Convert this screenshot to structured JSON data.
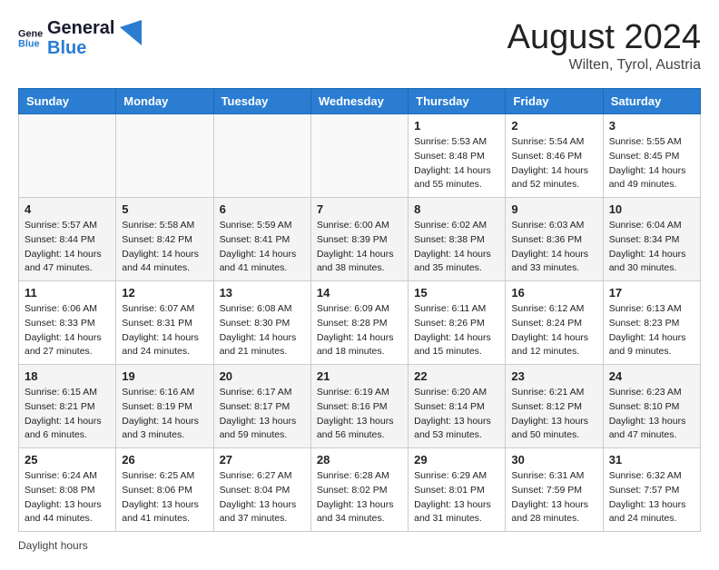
{
  "header": {
    "logo_general": "General",
    "logo_blue": "Blue",
    "month_title": "August 2024",
    "location": "Wilten, Tyrol, Austria"
  },
  "calendar": {
    "days_of_week": [
      "Sunday",
      "Monday",
      "Tuesday",
      "Wednesday",
      "Thursday",
      "Friday",
      "Saturday"
    ],
    "weeks": [
      [
        {
          "day": "",
          "info": ""
        },
        {
          "day": "",
          "info": ""
        },
        {
          "day": "",
          "info": ""
        },
        {
          "day": "",
          "info": ""
        },
        {
          "day": "1",
          "info": "Sunrise: 5:53 AM\nSunset: 8:48 PM\nDaylight: 14 hours and 55 minutes."
        },
        {
          "day": "2",
          "info": "Sunrise: 5:54 AM\nSunset: 8:46 PM\nDaylight: 14 hours and 52 minutes."
        },
        {
          "day": "3",
          "info": "Sunrise: 5:55 AM\nSunset: 8:45 PM\nDaylight: 14 hours and 49 minutes."
        }
      ],
      [
        {
          "day": "4",
          "info": "Sunrise: 5:57 AM\nSunset: 8:44 PM\nDaylight: 14 hours and 47 minutes."
        },
        {
          "day": "5",
          "info": "Sunrise: 5:58 AM\nSunset: 8:42 PM\nDaylight: 14 hours and 44 minutes."
        },
        {
          "day": "6",
          "info": "Sunrise: 5:59 AM\nSunset: 8:41 PM\nDaylight: 14 hours and 41 minutes."
        },
        {
          "day": "7",
          "info": "Sunrise: 6:00 AM\nSunset: 8:39 PM\nDaylight: 14 hours and 38 minutes."
        },
        {
          "day": "8",
          "info": "Sunrise: 6:02 AM\nSunset: 8:38 PM\nDaylight: 14 hours and 35 minutes."
        },
        {
          "day": "9",
          "info": "Sunrise: 6:03 AM\nSunset: 8:36 PM\nDaylight: 14 hours and 33 minutes."
        },
        {
          "day": "10",
          "info": "Sunrise: 6:04 AM\nSunset: 8:34 PM\nDaylight: 14 hours and 30 minutes."
        }
      ],
      [
        {
          "day": "11",
          "info": "Sunrise: 6:06 AM\nSunset: 8:33 PM\nDaylight: 14 hours and 27 minutes."
        },
        {
          "day": "12",
          "info": "Sunrise: 6:07 AM\nSunset: 8:31 PM\nDaylight: 14 hours and 24 minutes."
        },
        {
          "day": "13",
          "info": "Sunrise: 6:08 AM\nSunset: 8:30 PM\nDaylight: 14 hours and 21 minutes."
        },
        {
          "day": "14",
          "info": "Sunrise: 6:09 AM\nSunset: 8:28 PM\nDaylight: 14 hours and 18 minutes."
        },
        {
          "day": "15",
          "info": "Sunrise: 6:11 AM\nSunset: 8:26 PM\nDaylight: 14 hours and 15 minutes."
        },
        {
          "day": "16",
          "info": "Sunrise: 6:12 AM\nSunset: 8:24 PM\nDaylight: 14 hours and 12 minutes."
        },
        {
          "day": "17",
          "info": "Sunrise: 6:13 AM\nSunset: 8:23 PM\nDaylight: 14 hours and 9 minutes."
        }
      ],
      [
        {
          "day": "18",
          "info": "Sunrise: 6:15 AM\nSunset: 8:21 PM\nDaylight: 14 hours and 6 minutes."
        },
        {
          "day": "19",
          "info": "Sunrise: 6:16 AM\nSunset: 8:19 PM\nDaylight: 14 hours and 3 minutes."
        },
        {
          "day": "20",
          "info": "Sunrise: 6:17 AM\nSunset: 8:17 PM\nDaylight: 13 hours and 59 minutes."
        },
        {
          "day": "21",
          "info": "Sunrise: 6:19 AM\nSunset: 8:16 PM\nDaylight: 13 hours and 56 minutes."
        },
        {
          "day": "22",
          "info": "Sunrise: 6:20 AM\nSunset: 8:14 PM\nDaylight: 13 hours and 53 minutes."
        },
        {
          "day": "23",
          "info": "Sunrise: 6:21 AM\nSunset: 8:12 PM\nDaylight: 13 hours and 50 minutes."
        },
        {
          "day": "24",
          "info": "Sunrise: 6:23 AM\nSunset: 8:10 PM\nDaylight: 13 hours and 47 minutes."
        }
      ],
      [
        {
          "day": "25",
          "info": "Sunrise: 6:24 AM\nSunset: 8:08 PM\nDaylight: 13 hours and 44 minutes."
        },
        {
          "day": "26",
          "info": "Sunrise: 6:25 AM\nSunset: 8:06 PM\nDaylight: 13 hours and 41 minutes."
        },
        {
          "day": "27",
          "info": "Sunrise: 6:27 AM\nSunset: 8:04 PM\nDaylight: 13 hours and 37 minutes."
        },
        {
          "day": "28",
          "info": "Sunrise: 6:28 AM\nSunset: 8:02 PM\nDaylight: 13 hours and 34 minutes."
        },
        {
          "day": "29",
          "info": "Sunrise: 6:29 AM\nSunset: 8:01 PM\nDaylight: 13 hours and 31 minutes."
        },
        {
          "day": "30",
          "info": "Sunrise: 6:31 AM\nSunset: 7:59 PM\nDaylight: 13 hours and 28 minutes."
        },
        {
          "day": "31",
          "info": "Sunrise: 6:32 AM\nSunset: 7:57 PM\nDaylight: 13 hours and 24 minutes."
        }
      ]
    ]
  },
  "footer": {
    "daylight_label": "Daylight hours"
  }
}
